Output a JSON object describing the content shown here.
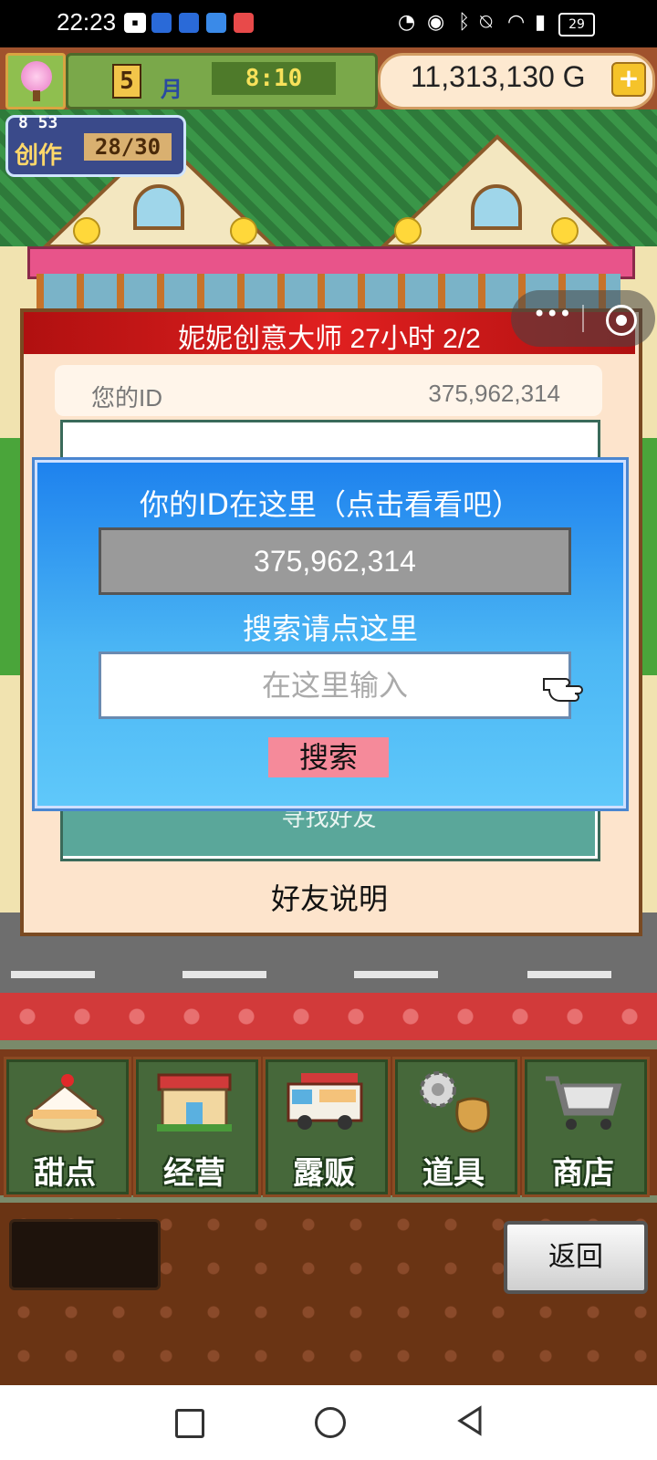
{
  "status_bar": {
    "time": "22:23",
    "battery": "29"
  },
  "top_bar": {
    "month": "5",
    "month_label": "月",
    "clock": "8:10",
    "money": "11,313,130 G",
    "plus": "+"
  },
  "badge": {
    "level": "8 53",
    "label": "创作",
    "count": "28/30"
  },
  "panel": {
    "title": "妮妮创意大师  27小时 2/2",
    "id_label": "您的ID",
    "id_value": "375,962,314",
    "find_friend": "寻找好友",
    "friend_help": "好友说明"
  },
  "dialog": {
    "title": "你的ID在这里（点击看看吧）",
    "id_value": "375,962,314",
    "search_label": "搜索请点这里",
    "input_placeholder": "在这里输入",
    "search_button": "搜索"
  },
  "menu": {
    "items": [
      {
        "label": "甜点",
        "icon": "cake-icon"
      },
      {
        "label": "经营",
        "icon": "shop-icon"
      },
      {
        "label": "露贩",
        "icon": "food-truck-icon"
      },
      {
        "label": "道具",
        "icon": "item-bag-icon"
      },
      {
        "label": "商店",
        "icon": "shopping-cart-icon"
      }
    ]
  },
  "back_button": "返回",
  "colors": {
    "dialog_gradient_top": "#1e82ee",
    "dialog_gradient_bottom": "#5fc8fa",
    "title_bar_red": "#c01010",
    "search_button_pink": "#f58a9a",
    "find_friend_teal": "#5aa79a"
  }
}
